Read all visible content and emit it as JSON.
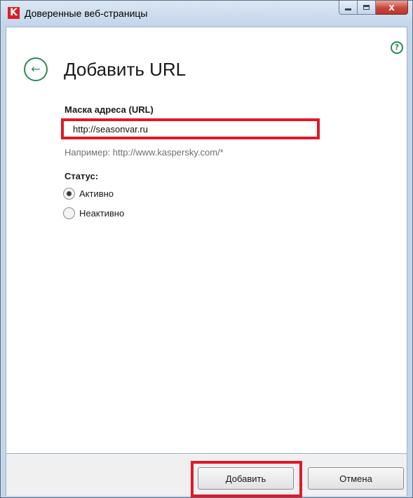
{
  "window": {
    "title": "Доверенные веб-страницы",
    "app_icon_glyph": "K",
    "close_glyph": "x"
  },
  "header": {
    "back_icon_glyph": "←",
    "help_icon_glyph": "?",
    "title": "Добавить URL"
  },
  "form": {
    "url_label": "Маска адреса (URL)",
    "url_value": "http://seasonvar.ru",
    "hint": "Например: http://www.kaspersky.com/*",
    "status_label": "Статус:",
    "status_options": [
      {
        "label": "Активно",
        "selected": true
      },
      {
        "label": "Неактивно",
        "selected": false
      }
    ]
  },
  "footer": {
    "add_label": "Добавить",
    "cancel_label": "Отмена"
  },
  "colors": {
    "accent_green": "#2a8c54",
    "highlight_red": "#e0182a",
    "brand_red": "#d81f27"
  }
}
